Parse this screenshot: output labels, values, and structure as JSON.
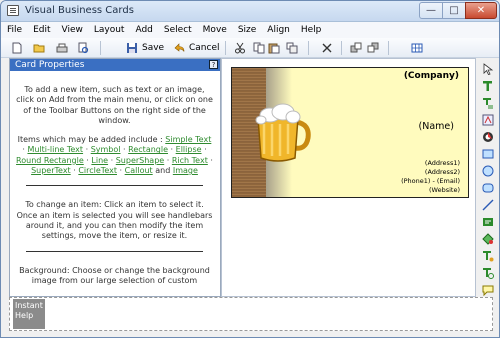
{
  "window": {
    "title": "Visual Business Cards",
    "min_glyph": "—",
    "max_glyph": "□",
    "close_glyph": "✕"
  },
  "menu": [
    "File",
    "Edit",
    "View",
    "Layout",
    "Add",
    "Select",
    "Move",
    "Size",
    "Align",
    "Help"
  ],
  "toolbar": {
    "save_label": "Save",
    "cancel_label": "Cancel"
  },
  "panel": {
    "title": "Card Properties",
    "help_glyph": "?",
    "intro": "To add a new item, such as text or an image, click on Add from the main menu, or click on one of the Toolbar Buttons on the right side of the window.",
    "items_prefix": "Items which may be added include :",
    "items": [
      "Simple Text",
      "Multi-line Text",
      "Symbol",
      "Rectangle",
      "Ellipse",
      "Round Rectangle",
      "Line",
      "SuperShape",
      "Rich Text",
      "SuperText",
      "CircleText",
      "Callout"
    ],
    "items_and": "and",
    "items_last": "Image",
    "change_text": "To change an item: Click an item to select it. Once an item is selected you will see handlebars around it, and you can then modify the item settings, move the item, or resize it.",
    "background_text": "Background: Choose or change the background image from our large selection of custom"
  },
  "card": {
    "company": "(Company)",
    "name": "(Name)",
    "address1": "(Address1)",
    "address2": "(Address2)",
    "phone_email": "(Phone1) - (Email)",
    "website": "(Website)"
  },
  "instant_help": {
    "label": "Instant Help"
  },
  "colors": {
    "panel_header": "#3a6fc2",
    "link": "#2e8b2e",
    "card_bg": "#fffbbe"
  }
}
